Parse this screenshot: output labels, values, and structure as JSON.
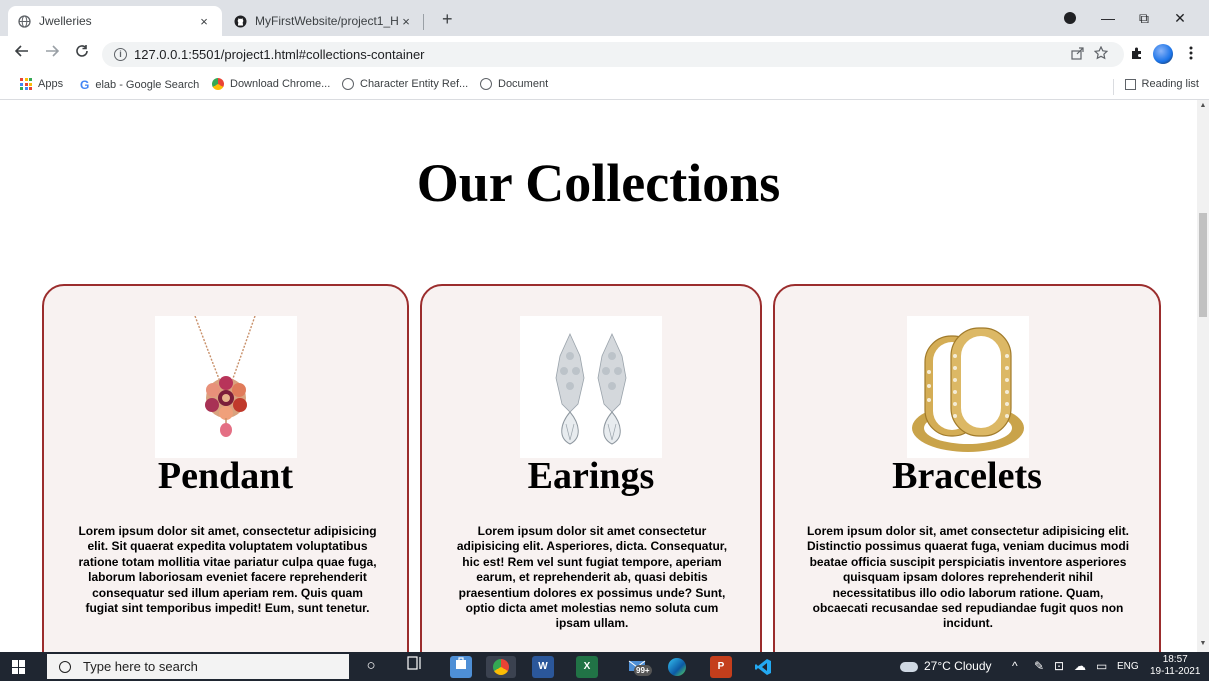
{
  "browser": {
    "tabs": [
      {
        "title": "Jwelleries",
        "active": true
      },
      {
        "title": "MyFirstWebsite/project1_HTML.t",
        "active": false
      }
    ],
    "new_tab": "+",
    "close": "×",
    "window": {
      "minimize": "—",
      "restore": "⧉",
      "close": "✕"
    },
    "url": "127.0.0.1:5501/project1.html#collections-container",
    "url_info": "i",
    "bookmarks": [
      {
        "label": "Apps"
      },
      {
        "label": "elab - Google Search"
      },
      {
        "label": "Download Chrome..."
      },
      {
        "label": "Character Entity Ref..."
      },
      {
        "label": "Document"
      }
    ],
    "reading_list": "Reading list"
  },
  "page": {
    "title": "Our Collections",
    "cards": [
      {
        "title": "Pendant",
        "description": "Lorem ipsum dolor sit amet, consectetur adipisicing elit. Sit quaerat expedita voluptatem voluptatibus ratione totam mollitia vitae pariatur culpa quae fuga, laborum laboriosam eveniet facere reprehenderit consequatur sed illum aperiam rem. Quis quam fugiat sint temporibus impedit! Eum, sunt tenetur."
      },
      {
        "title": "Earings",
        "description": "Lorem ipsum dolor sit amet consectetur adipisicing elit. Asperiores, dicta. Consequatur, hic est! Rem vel sunt fugiat tempore, aperiam earum, et reprehenderit ab, quasi debitis praesentium dolores ex possimus unde? Sunt, optio dicta amet molestias nemo soluta cum ipsam ullam."
      },
      {
        "title": "Bracelets",
        "description": "Lorem ipsum dolor sit, amet consectetur adipisicing elit. Distinctio possimus quaerat fuga, veniam ducimus modi beatae officia suscipit perspiciatis inventore asperiores quisquam ipsam dolores reprehenderit nihil necessitatibus illo odio laborum ratione. Quam, obcaecati recusandae sed repudiandae fugit quos non incidunt."
      }
    ]
  },
  "taskbar": {
    "search_placeholder": "Type here to search",
    "badge": "99+",
    "weather": "27°C  Cloudy",
    "language": "ENG",
    "time": "18:57",
    "date": "19-11-2021"
  },
  "colors": {
    "card_border": "#9b2d2d",
    "card_background": "#f8f2f1",
    "taskbar": "#1f2631"
  }
}
